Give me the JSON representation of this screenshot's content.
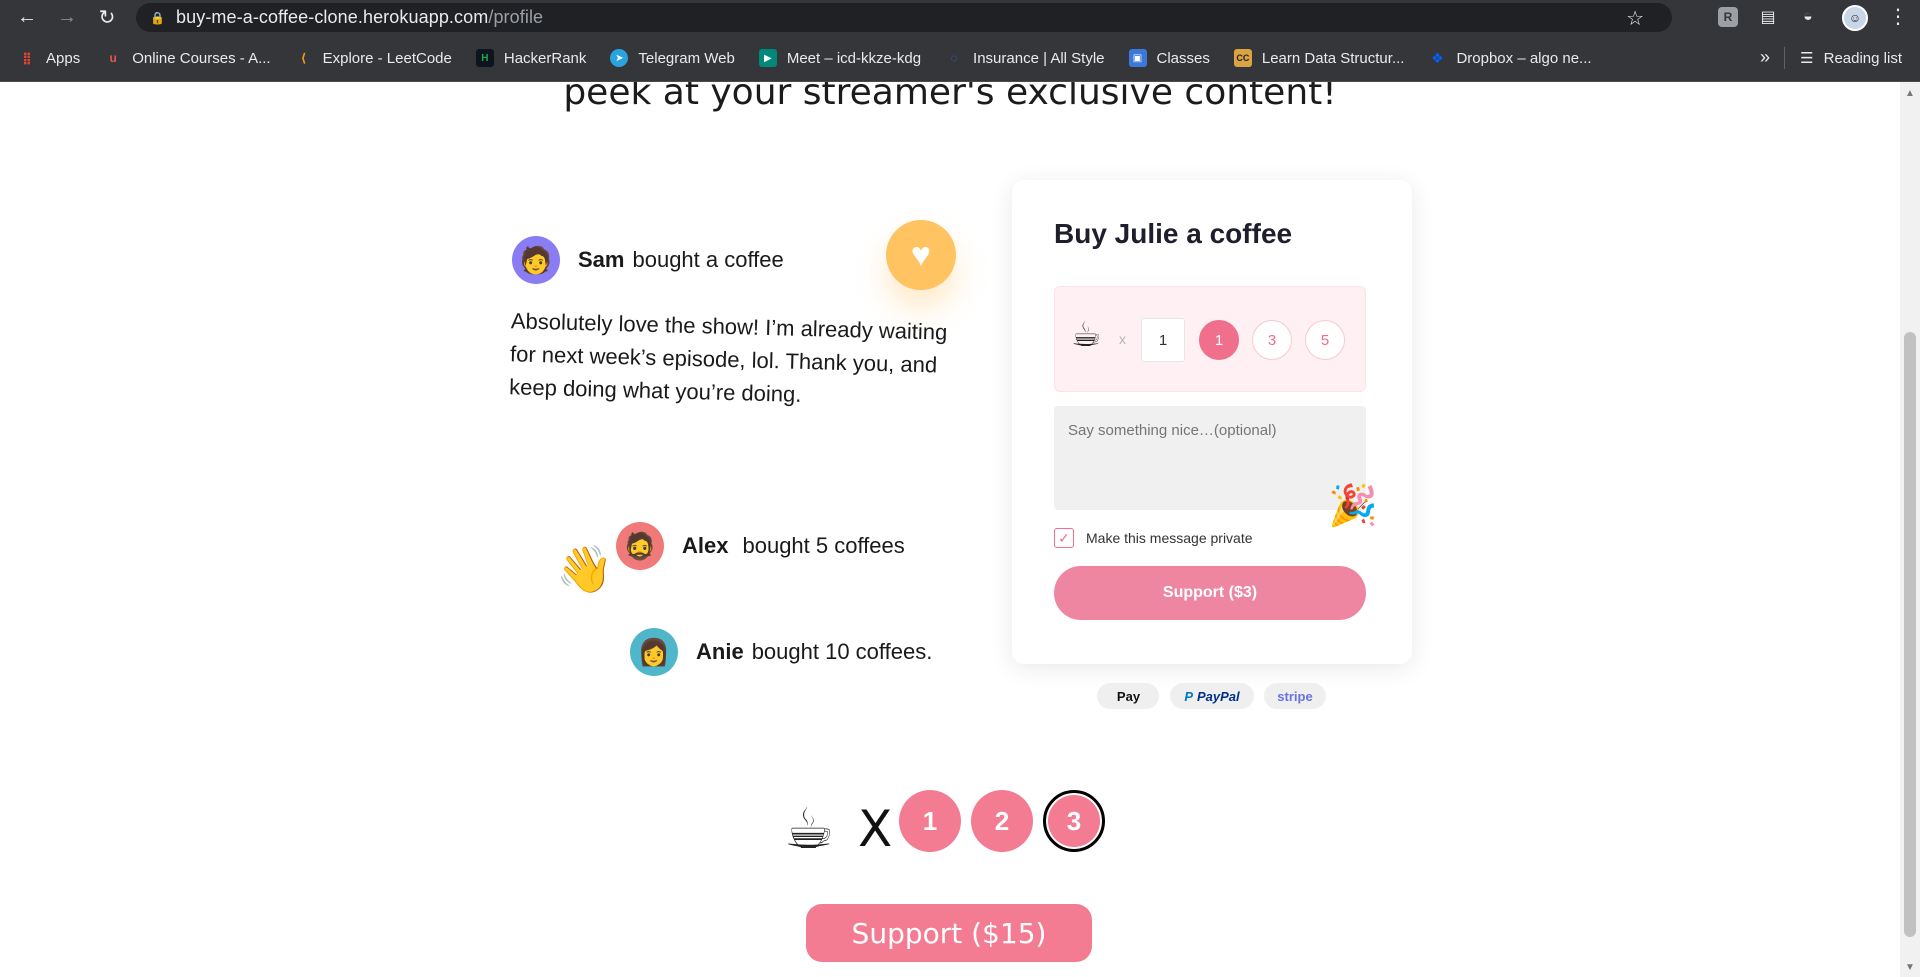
{
  "browser": {
    "url_host": "buy-me-a-coffee-clone.herokuapp.com",
    "url_path": "/profile",
    "bookmarks": [
      {
        "label": "Apps",
        "icon": "apps-grid-icon",
        "color": "#ea4335"
      },
      {
        "label": "Online Courses - A...",
        "icon": "udemy-icon",
        "color": "#ec5252"
      },
      {
        "label": "Explore - LeetCode",
        "icon": "leetcode-icon",
        "color": "#f89f1b"
      },
      {
        "label": "HackerRank",
        "icon": "hackerrank-icon",
        "color": "#1ba94c"
      },
      {
        "label": "Telegram Web",
        "icon": "telegram-icon",
        "color": "#2aa3df"
      },
      {
        "label": "Meet – icd-kkze-kdg",
        "icon": "meet-icon",
        "color": "#00897b"
      },
      {
        "label": "Insurance | All Style",
        "icon": "insurance-icon",
        "color": "#1a73e8"
      },
      {
        "label": "Classes",
        "icon": "classroom-icon",
        "color": "#3c78d8"
      },
      {
        "label": "Learn Data Structur...",
        "icon": "cc-icon",
        "color": "#d9a441"
      },
      {
        "label": "Dropbox – algo ne...",
        "icon": "dropbox-icon",
        "color": "#0061fe"
      }
    ],
    "reading_list": "Reading list"
  },
  "page": {
    "headline": "peek at your streamer's exclusive content!",
    "supporters": [
      {
        "name": "Sam",
        "action": "bought a coffee"
      },
      {
        "name": "Alex",
        "action": "bought 5 coffees"
      },
      {
        "name": "Anie",
        "action": "bought 10 coffees."
      }
    ],
    "quote": "Absolutely love the show! I’m already waiting for next week’s episode, lol. Thank you, and keep doing what you’re doing.",
    "card": {
      "title": "Buy Julie a coffee",
      "x_label": "x",
      "qty_value": "1",
      "qty_options": [
        "1",
        "3",
        "5"
      ],
      "message_placeholder": "Say something nice…(optional)",
      "private_label": "Make this message private",
      "private_checked": true,
      "support_label": "Support ($3)"
    },
    "payments": [
      "Pay",
      "PayPal",
      "stripe"
    ],
    "selector": {
      "x_label": "X",
      "options": [
        "1",
        "2",
        "3"
      ],
      "selected": "3",
      "support_label": "Support ($15)"
    }
  },
  "colors": {
    "accent_pink": "#ef6f8c",
    "heart_yellow": "#ffc361"
  }
}
